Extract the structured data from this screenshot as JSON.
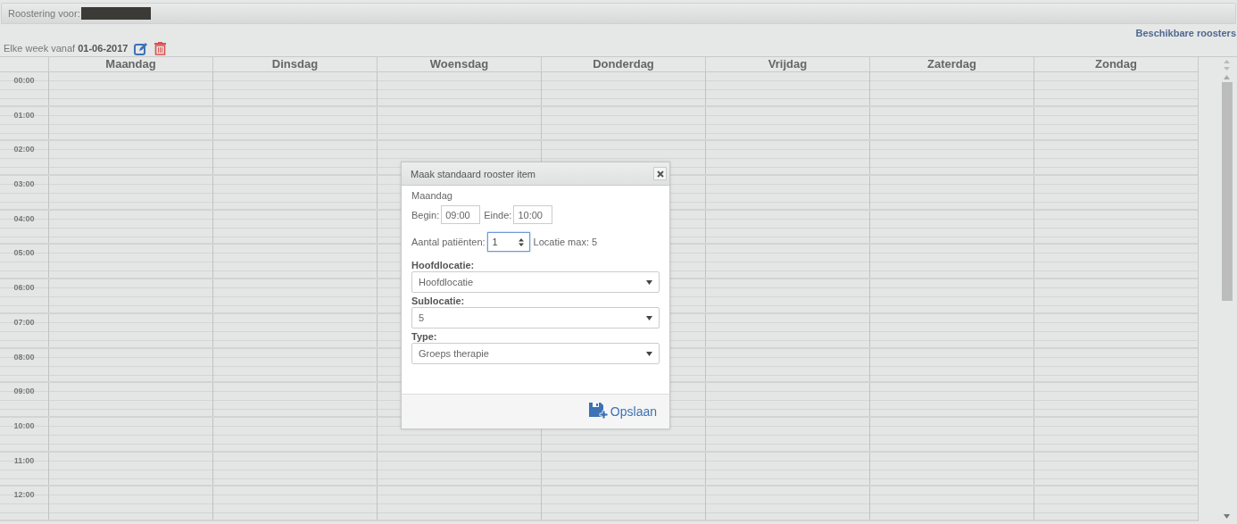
{
  "header": {
    "title": "Roostering voor:"
  },
  "link": "Beschikbare roosters",
  "recurrence": {
    "prefix": "Elke week vanaf",
    "date": "01-06-2017"
  },
  "days": [
    "Maandag",
    "Dinsdag",
    "Woensdag",
    "Donderdag",
    "Vrijdag",
    "Zaterdag",
    "Zondag"
  ],
  "times": [
    "00:00",
    "01:00",
    "02:00",
    "03:00",
    "04:00",
    "05:00",
    "06:00",
    "07:00",
    "08:00",
    "09:00",
    "10:00",
    "11:00",
    "12:00"
  ],
  "dialog": {
    "title": "Maak standaard rooster item",
    "day": "Maandag",
    "begin": {
      "label": "Begin:",
      "value": "09:00"
    },
    "end": {
      "label": "Einde:",
      "value": "10:00"
    },
    "patients": {
      "label": "Aantal patiënten:",
      "value": "1",
      "focused": true
    },
    "max": "Locatie max: 5",
    "selects": [
      {
        "label": "Hoofdlocatie:",
        "value": "Hoofdlocatie"
      },
      {
        "label": "Sublocatie:",
        "value": "5"
      },
      {
        "label": "Type:",
        "value": "Groeps therapie"
      }
    ],
    "save": "Opslaan"
  }
}
